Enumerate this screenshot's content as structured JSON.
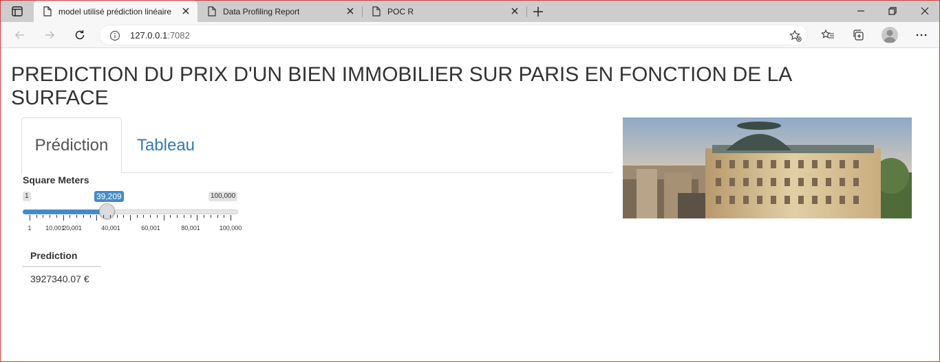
{
  "browser": {
    "tabs": [
      {
        "title": "model utilisé prédiction linéaire",
        "active": true
      },
      {
        "title": "Data Profiling Report",
        "active": false
      },
      {
        "title": "POC R",
        "active": false
      }
    ],
    "url_host": "127.0.0.1",
    "url_port": ":7082",
    "icons": [
      "tab-actions-icon",
      "page-icon",
      "close-icon",
      "new-tab-icon",
      "minimize-icon",
      "restore-icon",
      "window-close-icon",
      "back-icon",
      "forward-icon",
      "refresh-icon",
      "info-icon",
      "add-favorite-icon",
      "favorites-icon",
      "collections-icon",
      "profile-avatar",
      "more-icon"
    ]
  },
  "page": {
    "title": "PREDICTION DU PRIX D'UN BIEN IMMOBILIER SUR PARIS EN FONCTION DE LA SURFACE",
    "tabs": [
      {
        "label": "Prédiction",
        "active": true
      },
      {
        "label": "Tableau",
        "active": false
      }
    ],
    "slider": {
      "label": "Square Meters",
      "min": 1,
      "max": 100000,
      "value": 39209,
      "min_label": "1",
      "max_label": "100,000",
      "value_label": "39,209",
      "tick_labels": [
        "1",
        "10,001",
        "20,001",
        "40,001",
        "60,001",
        "80,001",
        "100,000"
      ]
    },
    "prediction": {
      "header": "Prediction",
      "value": "3927340.07 €"
    },
    "colors": {
      "accent": "#428bca",
      "link": "#337ab7",
      "title": "#333333"
    }
  }
}
